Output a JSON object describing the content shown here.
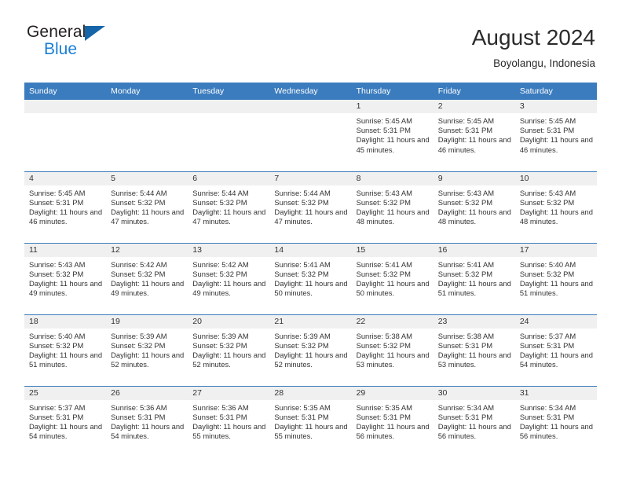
{
  "brand": {
    "name_part1": "General",
    "name_part2": "Blue",
    "accent_color": "#1a7fd4",
    "triangle_color": "#1665a8"
  },
  "header": {
    "title": "August 2024",
    "subtitle": "Boyolangu, Indonesia"
  },
  "calendar": {
    "header_color": "#3b7cbe",
    "weekdays": [
      "Sunday",
      "Monday",
      "Tuesday",
      "Wednesday",
      "Thursday",
      "Friday",
      "Saturday"
    ],
    "weeks": [
      [
        {
          "day": "",
          "empty": true
        },
        {
          "day": "",
          "empty": true
        },
        {
          "day": "",
          "empty": true
        },
        {
          "day": "",
          "empty": true
        },
        {
          "day": "1",
          "sunrise": "Sunrise: 5:45 AM",
          "sunset": "Sunset: 5:31 PM",
          "daylight": "Daylight: 11 hours and 45 minutes."
        },
        {
          "day": "2",
          "sunrise": "Sunrise: 5:45 AM",
          "sunset": "Sunset: 5:31 PM",
          "daylight": "Daylight: 11 hours and 46 minutes."
        },
        {
          "day": "3",
          "sunrise": "Sunrise: 5:45 AM",
          "sunset": "Sunset: 5:31 PM",
          "daylight": "Daylight: 11 hours and 46 minutes."
        }
      ],
      [
        {
          "day": "4",
          "sunrise": "Sunrise: 5:45 AM",
          "sunset": "Sunset: 5:31 PM",
          "daylight": "Daylight: 11 hours and 46 minutes."
        },
        {
          "day": "5",
          "sunrise": "Sunrise: 5:44 AM",
          "sunset": "Sunset: 5:32 PM",
          "daylight": "Daylight: 11 hours and 47 minutes."
        },
        {
          "day": "6",
          "sunrise": "Sunrise: 5:44 AM",
          "sunset": "Sunset: 5:32 PM",
          "daylight": "Daylight: 11 hours and 47 minutes."
        },
        {
          "day": "7",
          "sunrise": "Sunrise: 5:44 AM",
          "sunset": "Sunset: 5:32 PM",
          "daylight": "Daylight: 11 hours and 47 minutes."
        },
        {
          "day": "8",
          "sunrise": "Sunrise: 5:43 AM",
          "sunset": "Sunset: 5:32 PM",
          "daylight": "Daylight: 11 hours and 48 minutes."
        },
        {
          "day": "9",
          "sunrise": "Sunrise: 5:43 AM",
          "sunset": "Sunset: 5:32 PM",
          "daylight": "Daylight: 11 hours and 48 minutes."
        },
        {
          "day": "10",
          "sunrise": "Sunrise: 5:43 AM",
          "sunset": "Sunset: 5:32 PM",
          "daylight": "Daylight: 11 hours and 48 minutes."
        }
      ],
      [
        {
          "day": "11",
          "sunrise": "Sunrise: 5:43 AM",
          "sunset": "Sunset: 5:32 PM",
          "daylight": "Daylight: 11 hours and 49 minutes."
        },
        {
          "day": "12",
          "sunrise": "Sunrise: 5:42 AM",
          "sunset": "Sunset: 5:32 PM",
          "daylight": "Daylight: 11 hours and 49 minutes."
        },
        {
          "day": "13",
          "sunrise": "Sunrise: 5:42 AM",
          "sunset": "Sunset: 5:32 PM",
          "daylight": "Daylight: 11 hours and 49 minutes."
        },
        {
          "day": "14",
          "sunrise": "Sunrise: 5:41 AM",
          "sunset": "Sunset: 5:32 PM",
          "daylight": "Daylight: 11 hours and 50 minutes."
        },
        {
          "day": "15",
          "sunrise": "Sunrise: 5:41 AM",
          "sunset": "Sunset: 5:32 PM",
          "daylight": "Daylight: 11 hours and 50 minutes."
        },
        {
          "day": "16",
          "sunrise": "Sunrise: 5:41 AM",
          "sunset": "Sunset: 5:32 PM",
          "daylight": "Daylight: 11 hours and 51 minutes."
        },
        {
          "day": "17",
          "sunrise": "Sunrise: 5:40 AM",
          "sunset": "Sunset: 5:32 PM",
          "daylight": "Daylight: 11 hours and 51 minutes."
        }
      ],
      [
        {
          "day": "18",
          "sunrise": "Sunrise: 5:40 AM",
          "sunset": "Sunset: 5:32 PM",
          "daylight": "Daylight: 11 hours and 51 minutes."
        },
        {
          "day": "19",
          "sunrise": "Sunrise: 5:39 AM",
          "sunset": "Sunset: 5:32 PM",
          "daylight": "Daylight: 11 hours and 52 minutes."
        },
        {
          "day": "20",
          "sunrise": "Sunrise: 5:39 AM",
          "sunset": "Sunset: 5:32 PM",
          "daylight": "Daylight: 11 hours and 52 minutes."
        },
        {
          "day": "21",
          "sunrise": "Sunrise: 5:39 AM",
          "sunset": "Sunset: 5:32 PM",
          "daylight": "Daylight: 11 hours and 52 minutes."
        },
        {
          "day": "22",
          "sunrise": "Sunrise: 5:38 AM",
          "sunset": "Sunset: 5:32 PM",
          "daylight": "Daylight: 11 hours and 53 minutes."
        },
        {
          "day": "23",
          "sunrise": "Sunrise: 5:38 AM",
          "sunset": "Sunset: 5:31 PM",
          "daylight": "Daylight: 11 hours and 53 minutes."
        },
        {
          "day": "24",
          "sunrise": "Sunrise: 5:37 AM",
          "sunset": "Sunset: 5:31 PM",
          "daylight": "Daylight: 11 hours and 54 minutes."
        }
      ],
      [
        {
          "day": "25",
          "sunrise": "Sunrise: 5:37 AM",
          "sunset": "Sunset: 5:31 PM",
          "daylight": "Daylight: 11 hours and 54 minutes."
        },
        {
          "day": "26",
          "sunrise": "Sunrise: 5:36 AM",
          "sunset": "Sunset: 5:31 PM",
          "daylight": "Daylight: 11 hours and 54 minutes."
        },
        {
          "day": "27",
          "sunrise": "Sunrise: 5:36 AM",
          "sunset": "Sunset: 5:31 PM",
          "daylight": "Daylight: 11 hours and 55 minutes."
        },
        {
          "day": "28",
          "sunrise": "Sunrise: 5:35 AM",
          "sunset": "Sunset: 5:31 PM",
          "daylight": "Daylight: 11 hours and 55 minutes."
        },
        {
          "day": "29",
          "sunrise": "Sunrise: 5:35 AM",
          "sunset": "Sunset: 5:31 PM",
          "daylight": "Daylight: 11 hours and 56 minutes."
        },
        {
          "day": "30",
          "sunrise": "Sunrise: 5:34 AM",
          "sunset": "Sunset: 5:31 PM",
          "daylight": "Daylight: 11 hours and 56 minutes."
        },
        {
          "day": "31",
          "sunrise": "Sunrise: 5:34 AM",
          "sunset": "Sunset: 5:31 PM",
          "daylight": "Daylight: 11 hours and 56 minutes."
        }
      ]
    ]
  }
}
